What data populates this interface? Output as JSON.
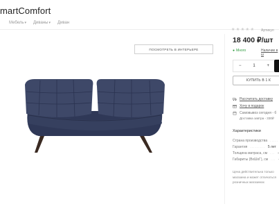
{
  "header": {
    "logo": "martComfort",
    "nav": [
      {
        "label": "Мебель",
        "chevron": "chevron-down-icon"
      },
      {
        "label": "Диваны",
        "chevron": "chevron-down-icon"
      },
      {
        "label": "Диван",
        "chevron": ""
      }
    ]
  },
  "gallery": {
    "view_in_interior_label": "ПОСМОТРЕТЬ В ИНТЕРЬЕРЕ",
    "sofa_color": "#3a4465"
  },
  "product": {
    "rating_stars": 5,
    "article_label": "Артикул",
    "price": "18 400 ₽/шт",
    "stock": "Много",
    "delivery_date_link": "Наличие в ш",
    "quantity": "1",
    "qty_minus": "−",
    "qty_plus": "+",
    "buy_one_click": "КУПИТЬ В 1 К",
    "services": [
      {
        "icon": "truck-icon",
        "label": "Рассчитать доставку",
        "underline": true
      },
      {
        "icon": "gift-icon",
        "label": "Хочу в подарок",
        "underline": true
      },
      {
        "icon": "store-icon",
        "label": "Самовывоз сегодня - б",
        "underline": false
      }
    ],
    "pickup_note": "Доставка завтра - 330₽",
    "characteristics_title": "Характеристики",
    "specs": [
      {
        "name": "Страна производства",
        "value": "—"
      },
      {
        "name": "Гарантия",
        "value": "5 лет"
      },
      {
        "name": "Толщина матраса, см",
        "value": "—"
      },
      {
        "name": "Габариты (ВхШхГ), см",
        "value": "—"
      }
    ],
    "note_lines": [
      "Цена действительна только",
      "магазина и может отличаться",
      "розничных магазинах"
    ]
  },
  "colors": {
    "stock_green": "#2e9a3e",
    "price_text": "#222222",
    "cart_button": "#111111"
  }
}
